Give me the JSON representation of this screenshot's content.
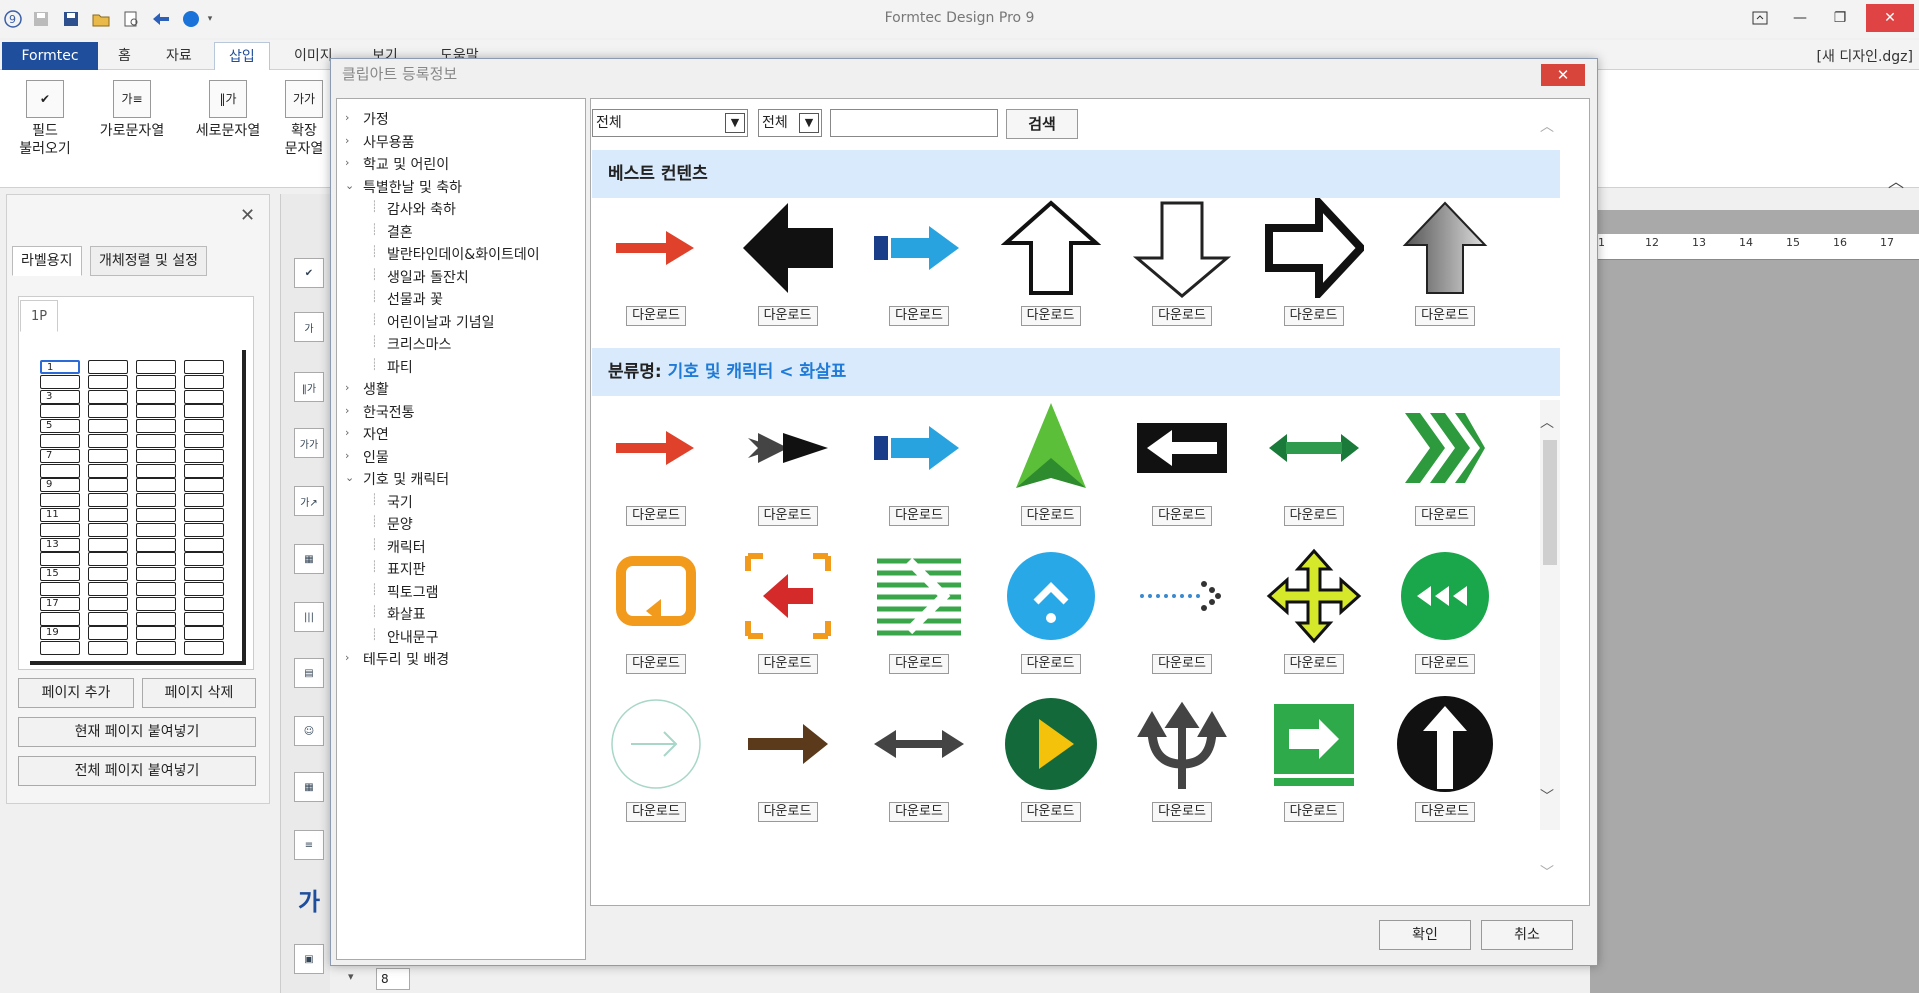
{
  "app": {
    "title": "Formtec Design Pro 9",
    "filename": "[새 디자인.dgz]"
  },
  "ribbon": {
    "tabs": [
      "Formtec",
      "홈",
      "자료",
      "삽입",
      "이미지",
      "보기",
      "도움말"
    ],
    "buttons": [
      "필드\n불러오기",
      "가로문자열",
      "세로문자열",
      "확장\n문자열"
    ]
  },
  "left_panel": {
    "tabs": [
      "라벨용지",
      "개체정렬 및 설정"
    ],
    "page_tab": "1P",
    "label_numbers": [
      "1",
      "3",
      "5",
      "7",
      "9",
      "11",
      "13",
      "15",
      "17",
      "19"
    ],
    "buttons": {
      "add_page": "페이지 추가",
      "delete_page": "페이지 삭제",
      "paste_current": "현재 페이지 붙여넣기",
      "paste_all": "전체 페이지 붙여넣기"
    }
  },
  "status": {
    "page_number": "8"
  },
  "dialog": {
    "title": "클립아트 등록정보",
    "tree": [
      {
        "label": "가정",
        "expanded": false
      },
      {
        "label": "사무용품",
        "expanded": false
      },
      {
        "label": "학교 및 어린이",
        "expanded": false
      },
      {
        "label": "특별한날 및 축하",
        "expanded": true,
        "children": [
          "감사와 축하",
          "결혼",
          "발란타인데이&화이트데이",
          "생일과 돌잔치",
          "선물과 꽃",
          "어린이날과 기념일",
          "크리스마스",
          "파티"
        ]
      },
      {
        "label": "생활",
        "expanded": false
      },
      {
        "label": "한국전통",
        "expanded": false
      },
      {
        "label": "자연",
        "expanded": false
      },
      {
        "label": "인물",
        "expanded": false
      },
      {
        "label": "기호 및 캐릭터",
        "expanded": true,
        "children": [
          "국기",
          "문양",
          "캐릭터",
          "표지판",
          "픽토그램",
          "화살표",
          "안내문구"
        ]
      },
      {
        "label": "테두리 및 배경",
        "expanded": false
      }
    ],
    "filter": {
      "scope": "전체",
      "field": "전체",
      "query": "",
      "search_label": "검색"
    },
    "best_section": "베스트 컨텐츠",
    "category_label": "분류명:",
    "category_path": "기호 및 캐릭터 < 화살표",
    "download_label": "다운로드",
    "ok_label": "확인",
    "cancel_label": "취소"
  },
  "clips": {
    "best": [
      "red-arrow-right",
      "black-arrow-left",
      "blue-arrow-right",
      "outline-arrow-up",
      "curl-arrow-down",
      "outline-arrow-right",
      "gray-arrow-up"
    ],
    "row1": [
      "red-arrow-right",
      "feather-arrow-right",
      "blue-arrow-right",
      "green-arrow-up",
      "box-arrow-left",
      "dotted-double-arrow",
      "green-chevrons"
    ],
    "row2": [
      "orange-loop-arrow",
      "red-target-arrow",
      "green-striped-arrow",
      "blue-circle-caret",
      "dotted-arrow-right",
      "yellow-four-way",
      "green-rewind-circle"
    ],
    "row3": [
      "thin-circle-arrow",
      "brown-arrow-right",
      "gray-double-arrow",
      "green-play-circle",
      "trident-arrows",
      "green-box-arrow",
      "black-circle-arrow-up"
    ]
  },
  "colors": {
    "accent": "#1e4e9c",
    "close": "#d8453b",
    "section": "#d8eafc",
    "category": "#1f7bd7"
  }
}
